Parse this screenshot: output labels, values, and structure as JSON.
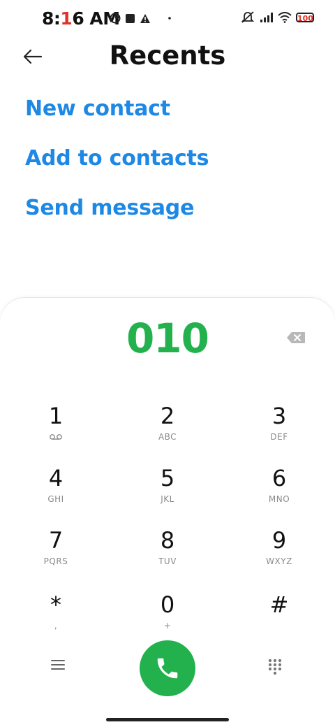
{
  "status_bar": {
    "time_prefix": "8:",
    "time_red": "1",
    "time_suffix": "6 AM",
    "battery_text": "100"
  },
  "header": {
    "title": "Recents"
  },
  "actions": {
    "new_contact": "New contact",
    "add_to_contacts": "Add to contacts",
    "send_message": "Send message"
  },
  "dialer": {
    "number": "010",
    "keys": [
      {
        "digit": "1",
        "letters": ""
      },
      {
        "digit": "2",
        "letters": "ABC"
      },
      {
        "digit": "3",
        "letters": "DEF"
      },
      {
        "digit": "4",
        "letters": "GHI"
      },
      {
        "digit": "5",
        "letters": "JKL"
      },
      {
        "digit": "6",
        "letters": "MNO"
      },
      {
        "digit": "7",
        "letters": "PQRS"
      },
      {
        "digit": "8",
        "letters": "TUV"
      },
      {
        "digit": "9",
        "letters": "WXYZ"
      },
      {
        "digit": "*",
        "letters": ","
      },
      {
        "digit": "0",
        "letters": "+"
      },
      {
        "digit": "#",
        "letters": ""
      }
    ]
  },
  "colors": {
    "accent_blue": "#1e88e5",
    "call_green": "#22b14c"
  }
}
